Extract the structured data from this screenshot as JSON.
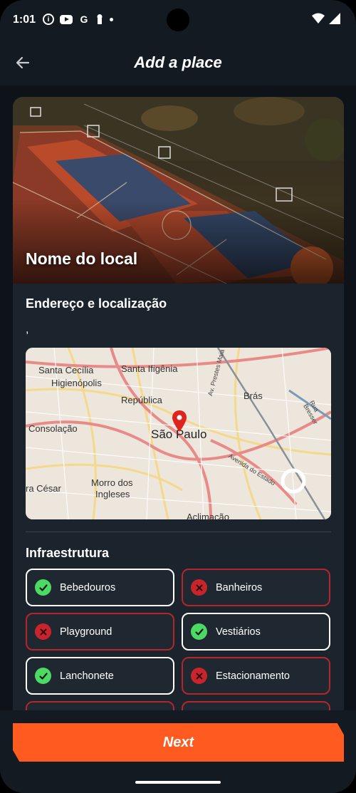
{
  "status_bar": {
    "time": "1:01",
    "google_letter": "G"
  },
  "header": {
    "title": "Add a place"
  },
  "place": {
    "name": "Nome do local"
  },
  "address": {
    "title": "Endereço e localização",
    "value": ","
  },
  "map": {
    "labels": [
      "Santa Cecília",
      "Santa Ifigênia",
      "Higienópolis",
      "República",
      "Consolação",
      "Brás",
      "Morro dos",
      "Ingleses",
      "ra César",
      "Aclimação"
    ],
    "city": "São Paulo",
    "roads": [
      "Avenida do Estado",
      "Rua Bresser",
      "Av. Prestes Maia"
    ]
  },
  "infra": {
    "title": "Infraestrutura",
    "items": [
      {
        "label": "Bebedouros",
        "available": true
      },
      {
        "label": "Banheiros",
        "available": false
      },
      {
        "label": "Playground",
        "available": false
      },
      {
        "label": "Vestiários",
        "available": true
      },
      {
        "label": "Lanchonete",
        "available": true
      },
      {
        "label": "Estacionamento",
        "available": false
      }
    ]
  },
  "footer": {
    "next_label": "Next"
  },
  "colors": {
    "accent": "#ff5a1f",
    "available": "#4cd964",
    "unavailable": "#c9242b",
    "background": "#131a21"
  }
}
